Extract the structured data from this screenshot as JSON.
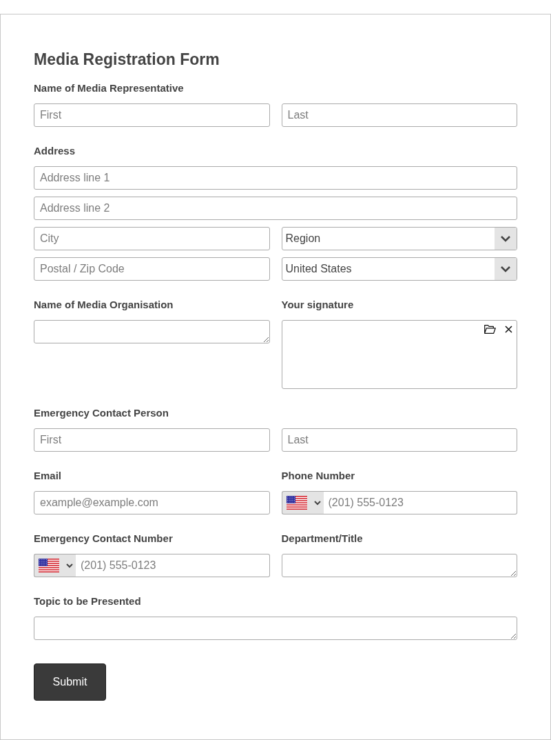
{
  "form": {
    "title": "Media Registration Form",
    "groups": [
      {
        "kind": "name",
        "label": "Name of Media Representative",
        "first": {
          "placeholder": "First"
        },
        "last": {
          "placeholder": "Last"
        }
      },
      {
        "kind": "address",
        "label": "Address",
        "lines": [
          {
            "placeholder": "Address line 1"
          },
          {
            "placeholder": "Address line 2"
          }
        ],
        "city": {
          "placeholder": "City"
        },
        "region": {
          "value": "Region"
        },
        "postal": {
          "placeholder": "Postal / Zip Code"
        },
        "country": {
          "value": "United States"
        }
      },
      {
        "kind": "pair",
        "fields": [
          {
            "kind": "textarea",
            "label": "Name of Media Organisation"
          },
          {
            "kind": "signature",
            "label": "Your signature"
          }
        ]
      },
      {
        "kind": "name",
        "label": "Emergency Contact Person",
        "first": {
          "placeholder": "First"
        },
        "last": {
          "placeholder": "Last"
        }
      },
      {
        "kind": "pair",
        "fields": [
          {
            "kind": "text",
            "label": "Email",
            "placeholder": "example@example.com"
          },
          {
            "kind": "phone",
            "label": "Phone Number",
            "placeholder": "(201) 555-0123"
          }
        ]
      },
      {
        "kind": "pair",
        "fields": [
          {
            "kind": "phone",
            "label": "Emergency Contact Number",
            "placeholder": "(201) 555-0123"
          },
          {
            "kind": "textarea",
            "label": "Department/Title"
          }
        ]
      },
      {
        "kind": "single",
        "fields": [
          {
            "kind": "textarea",
            "label": "Topic to be Presented"
          }
        ]
      }
    ],
    "submit": "Submit"
  }
}
